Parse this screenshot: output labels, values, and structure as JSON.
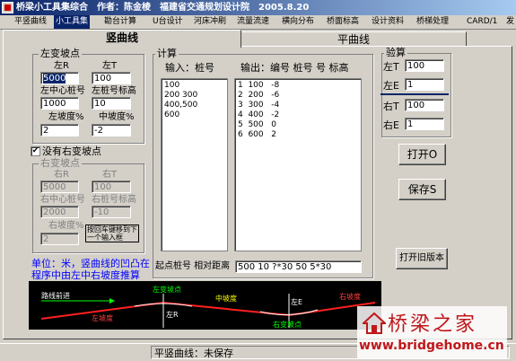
{
  "window": {
    "title": "桥梁小工具集综合　作者：陈金棱　福建省交通规划设计院　2005.8.20"
  },
  "menu": [
    {
      "label": "平竖曲线"
    },
    {
      "label": "小工具集"
    },
    {
      "label": "勘台计算"
    },
    {
      "label": "U台设计"
    },
    {
      "label": "河床冲刷"
    },
    {
      "label": "流量流速"
    },
    {
      "label": "横向分布"
    },
    {
      "label": "桥面标高"
    },
    {
      "label": "设计资料"
    },
    {
      "label": "桥梯处理"
    },
    {
      "label": "CARD/1"
    },
    {
      "label": "发"
    }
  ],
  "tabs": [
    {
      "label": "竖曲线"
    },
    {
      "label": "平曲线"
    }
  ],
  "left_point": {
    "legend": "左变坡点",
    "r_label": "左R",
    "r_value": "5000",
    "t_label": "左T",
    "t_value": "100",
    "center_label": "左中心桩号",
    "center_value": "1000",
    "stake_elev_label": "左桩号标高",
    "stake_elev_value": "10",
    "slope_label": "左坡度%",
    "slope_value": "2",
    "mid_slope_label": "中坡度%",
    "mid_slope_value": "-2"
  },
  "no_right_checkbox": {
    "label": "没有右变坡点",
    "checked": true
  },
  "right_point": {
    "legend": "右变坡点",
    "r_label": "右R",
    "r_value": "5000",
    "t_label": "右T",
    "t_value": "100",
    "center_label": "右中心桩号",
    "center_value": "2000",
    "stake_elev_label": "右桩号标高",
    "stake_elev_value": "-10",
    "slope_label": "右坡度%",
    "slope_value": "2",
    "hint_line1": "按回车键移到下",
    "hint_line2": "一个输入框"
  },
  "unit_note": {
    "line1": "单位：米，竖曲线的凹凸在",
    "line2": "程序中由左中右坡度推算"
  },
  "calc": {
    "legend": "计算",
    "input_label": "输入：桩号",
    "output_label": "输出：编号 桩号 号 标高",
    "input_lines": [
      "100",
      "200 300",
      "400,500",
      "600"
    ],
    "output_lines": [
      "1  100   -8",
      "2  200   -6",
      "3  300   -4",
      "4  400   -2",
      "5  500   0",
      "6  600   2"
    ],
    "start_label": "起点桩号 相对距离",
    "start_value": "500 10 ?*30 50 5*30"
  },
  "check": {
    "legend": "验算",
    "left_t_label": "左T",
    "left_t_value": "100",
    "left_e_label": "左E",
    "left_e_value": "1",
    "right_t_label": "右T",
    "right_t_value": "100",
    "right_e_label": "右E",
    "right_e_value": "1"
  },
  "buttons": {
    "open": "打开O",
    "save": "保存S",
    "open_old": "打开旧版本"
  },
  "diagram": {
    "label_forward": "路线前进",
    "label_left_slope": "左坡度",
    "label_left_point": "左变坡点",
    "label_mid_slope": "中坡度",
    "label_left_r": "左R",
    "label_left_e": "左E",
    "label_right_point": "右变坡点",
    "label_right_slope": "右坡度"
  },
  "status": {
    "text": "平竖曲线：未保存"
  },
  "watermark": {
    "title": "桥梁之家",
    "url": "www.bridgehome.cn"
  },
  "colors": {
    "window_bg": "#d4d0c8",
    "title_start": "#0a246a",
    "title_end": "#a6caf0",
    "note_blue": "#0000ff",
    "diagram_line": "#ff2020",
    "diagram_text_green": "#00ff00",
    "watermark_red": "#c0171a"
  }
}
